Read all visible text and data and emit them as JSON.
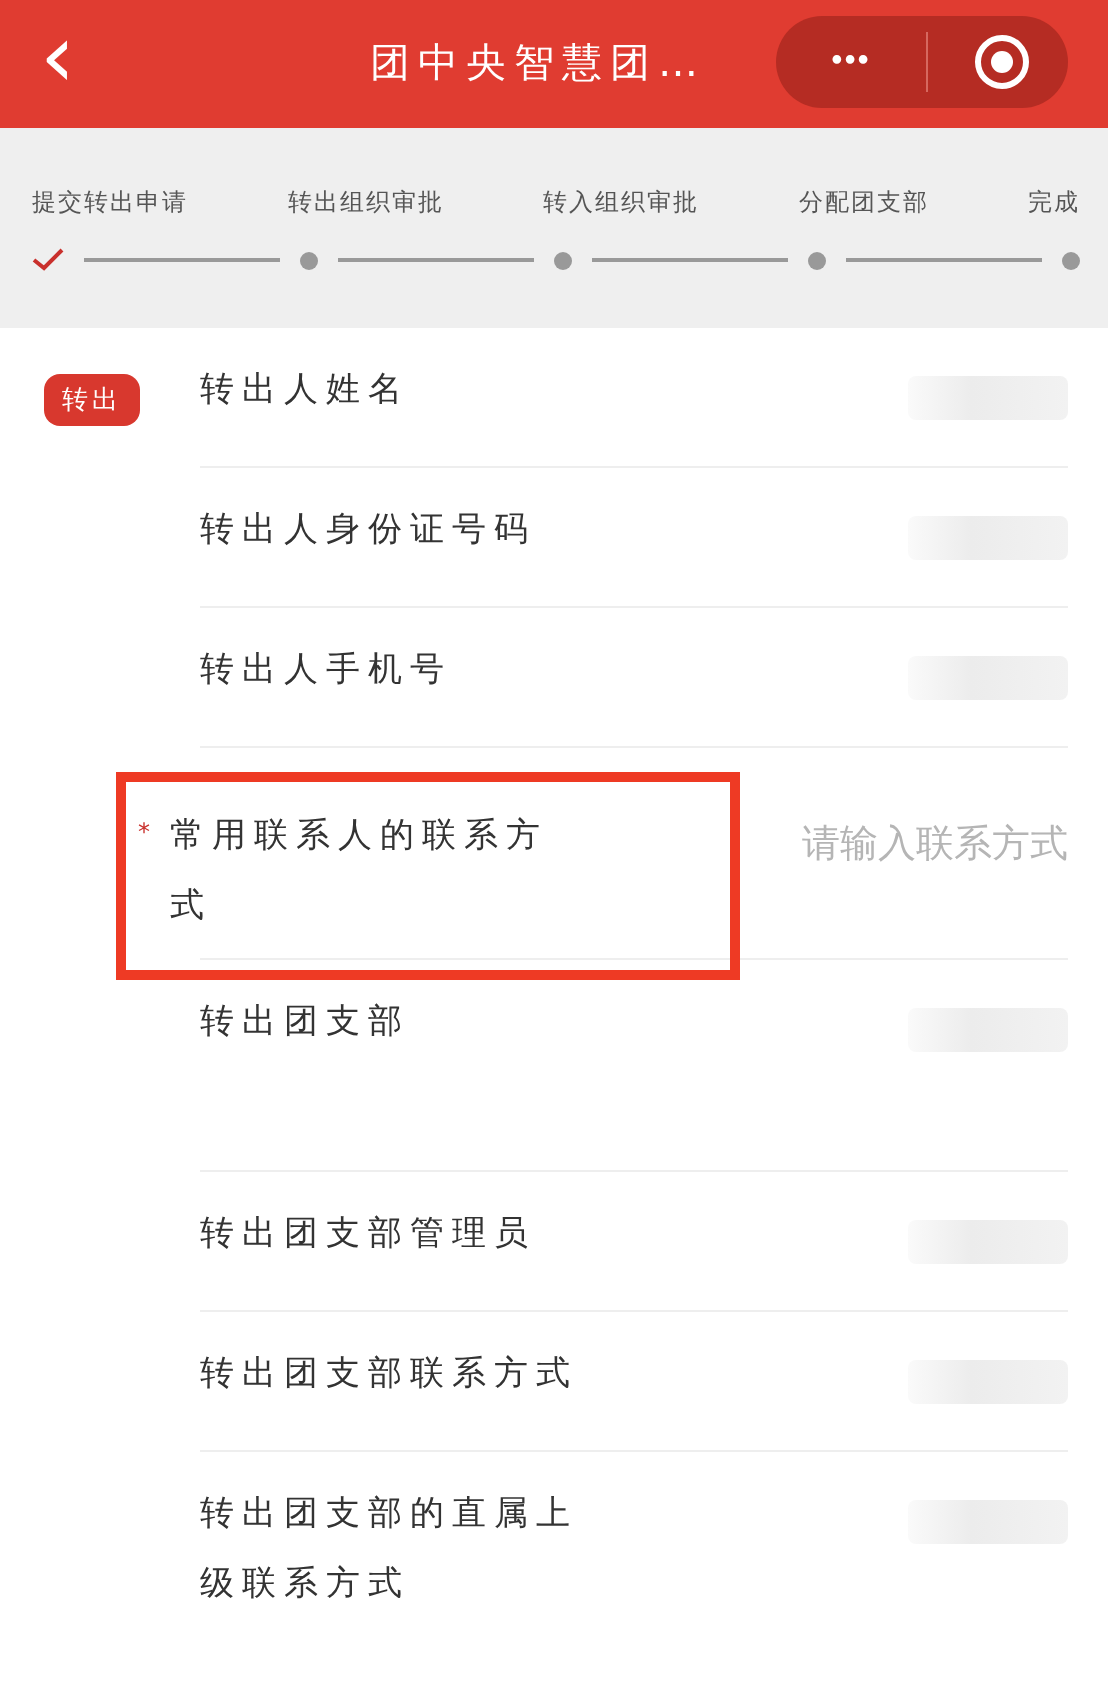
{
  "header": {
    "back": "‹",
    "title": "团中央智慧团…",
    "more": "•••"
  },
  "steps": [
    {
      "label": "提交转出申请",
      "done": true
    },
    {
      "label": "转出组织审批",
      "done": false
    },
    {
      "label": "转入组织审批",
      "done": false
    },
    {
      "label": "分配团支部",
      "done": false
    },
    {
      "label": "完成",
      "done": false
    }
  ],
  "section_tag": "转出",
  "fields": [
    {
      "label": "转出人姓名",
      "redacted": true
    },
    {
      "label": "转出人身份证号码",
      "redacted": true
    },
    {
      "label": "转出人手机号",
      "redacted": true
    },
    {
      "label": "常用联系人的联系方式",
      "required_mark": "*",
      "highlighted": true,
      "placeholder": "请输入联系方式",
      "tall": true
    },
    {
      "label": "转出团支部",
      "redacted": true,
      "tall": true
    },
    {
      "label": "转出团支部管理员",
      "redacted": true
    },
    {
      "label": "转出团支部联系方式",
      "redacted": true
    },
    {
      "label": "转出团支部的直属上级联系方式",
      "redacted": true,
      "tall": true
    }
  ]
}
